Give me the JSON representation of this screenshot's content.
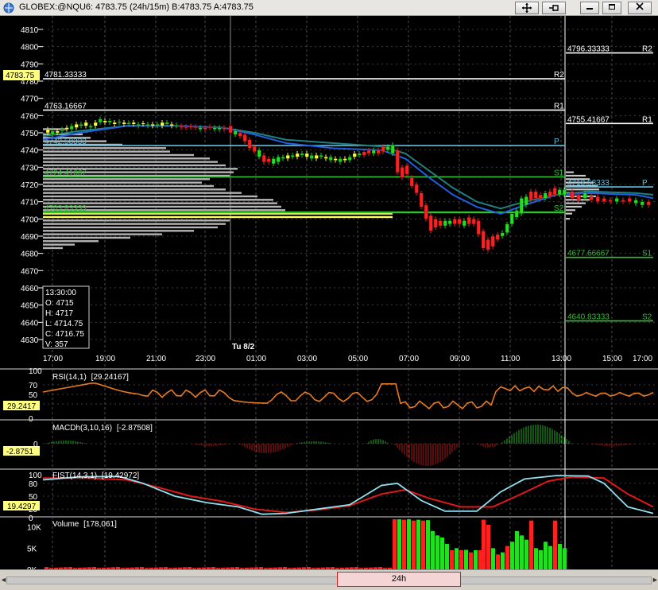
{
  "window": {
    "title_text": "GLOBEX:@NQU6: 4783.75 (24h/15m)  B:4783.75  A:4783.75",
    "icons": [
      "crosshair-icon",
      "pin-icon",
      "minimize-icon",
      "restore-icon",
      "close-icon"
    ]
  },
  "price_panel": {
    "y_ticks": [
      "4810",
      "4800",
      "4790",
      "4780",
      "4770",
      "4760",
      "4750",
      "4740",
      "4730",
      "4720",
      "4710",
      "4700",
      "4690",
      "4680",
      "4670",
      "4660",
      "4650",
      "4640",
      "4630"
    ],
    "current_price_badge": "4783.75",
    "levels_left": [
      {
        "value": "4781.33333",
        "tag": "R2",
        "color": "#ffffff"
      },
      {
        "value": "4763.16667",
        "tag": "R1",
        "color": "#ffffff"
      },
      {
        "value": "4742.58333",
        "tag": "P",
        "color": "#5fc0e0"
      },
      {
        "value": "4724.41667",
        "tag": "S1",
        "color": "#30c030"
      },
      {
        "value": "4703.83333",
        "tag": "S2",
        "color": "#30c030"
      }
    ],
    "levels_right": [
      {
        "value": "4796.33333",
        "tag": "R2",
        "color": "#ffffff"
      },
      {
        "value": "4755.41667",
        "tag": "R1",
        "color": "#ffffff"
      },
      {
        "value": "4718.58333",
        "tag": "P",
        "color": "#5fc0e0"
      },
      {
        "value": "4677.66667",
        "tag": "S1",
        "color": "#30c030"
      },
      {
        "value": "4640.83333",
        "tag": "S2",
        "color": "#30c030"
      }
    ],
    "day_divider_label": "Tu 8/2",
    "info_box": {
      "time": "13:30:00",
      "open": "O: 4715",
      "high": "H: 4717",
      "low": "L: 4714.75",
      "close": "C: 4716.75",
      "volume": "V: 357"
    },
    "time_labels": [
      "17:00",
      "19:00",
      "21:00",
      "23:00",
      "01:00",
      "03:00",
      "05:00",
      "07:00",
      "09:00",
      "11:00",
      "13:00",
      "15:00",
      "17:00"
    ]
  },
  "rsi_panel": {
    "label": "RSI(14,1)",
    "value": "[29.24167]",
    "badge": "29.2417",
    "ticks": [
      "100",
      "70",
      "50",
      "30",
      "0"
    ],
    "color": "#e87a20"
  },
  "macd_panel": {
    "label": "MACDh(3,10,16)",
    "value": "[-2.87508]",
    "badge": "-2.8751",
    "ticks": [
      "0"
    ]
  },
  "fist_panel": {
    "label": "FIST(14,3,1)",
    "value": "[19.42972]",
    "badge": "19.4297",
    "ticks": [
      "100",
      "80",
      "50",
      "20",
      "0"
    ],
    "colors": [
      "#e01818",
      "#90e0f0"
    ]
  },
  "volume_panel": {
    "label": "Volume",
    "value": "[178,061]",
    "ticks": [
      "10K",
      "5K",
      "0K"
    ]
  },
  "scrollbar": {
    "label": "24h"
  }
}
